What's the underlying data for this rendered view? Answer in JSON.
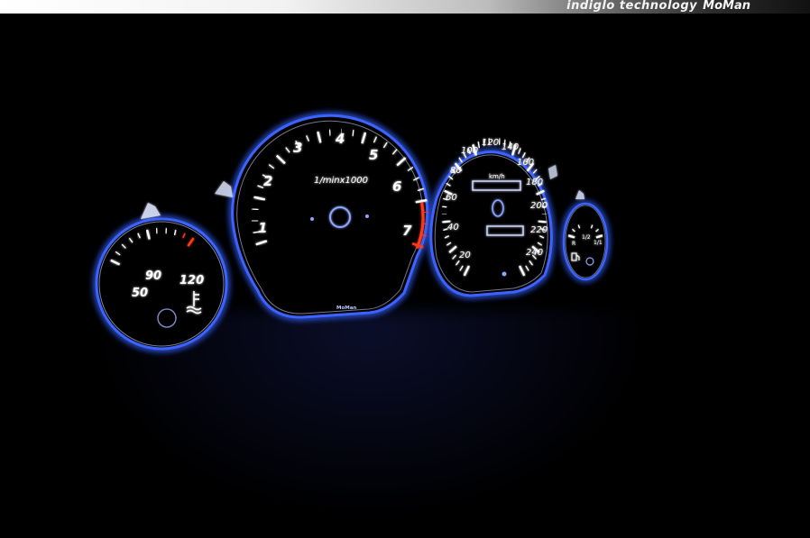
{
  "header": {
    "tagline": "indiglo technology",
    "brand": "MoMan"
  },
  "gauges": {
    "temperature": {
      "labels": [
        "50",
        "90",
        "120"
      ],
      "icon": "coolant-temperature-icon"
    },
    "tachometer": {
      "labels": [
        "1",
        "2",
        "3",
        "4",
        "5",
        "6",
        "7"
      ],
      "unit": "1/minx1000",
      "maker": "MoMan",
      "redline_color": "#ff3a1a"
    },
    "speedometer": {
      "labels": [
        "20",
        "40",
        "60",
        "80",
        "100",
        "120",
        "140",
        "160",
        "180",
        "200",
        "220",
        "240"
      ],
      "unit": "km/h"
    },
    "fuel": {
      "labels": [
        "R",
        "1/2",
        "1/1"
      ],
      "icon": "fuel-pump-icon"
    }
  },
  "colors": {
    "glow": "#2f5bff",
    "markings": "#ffffff",
    "redline": "#ff3a1a"
  }
}
